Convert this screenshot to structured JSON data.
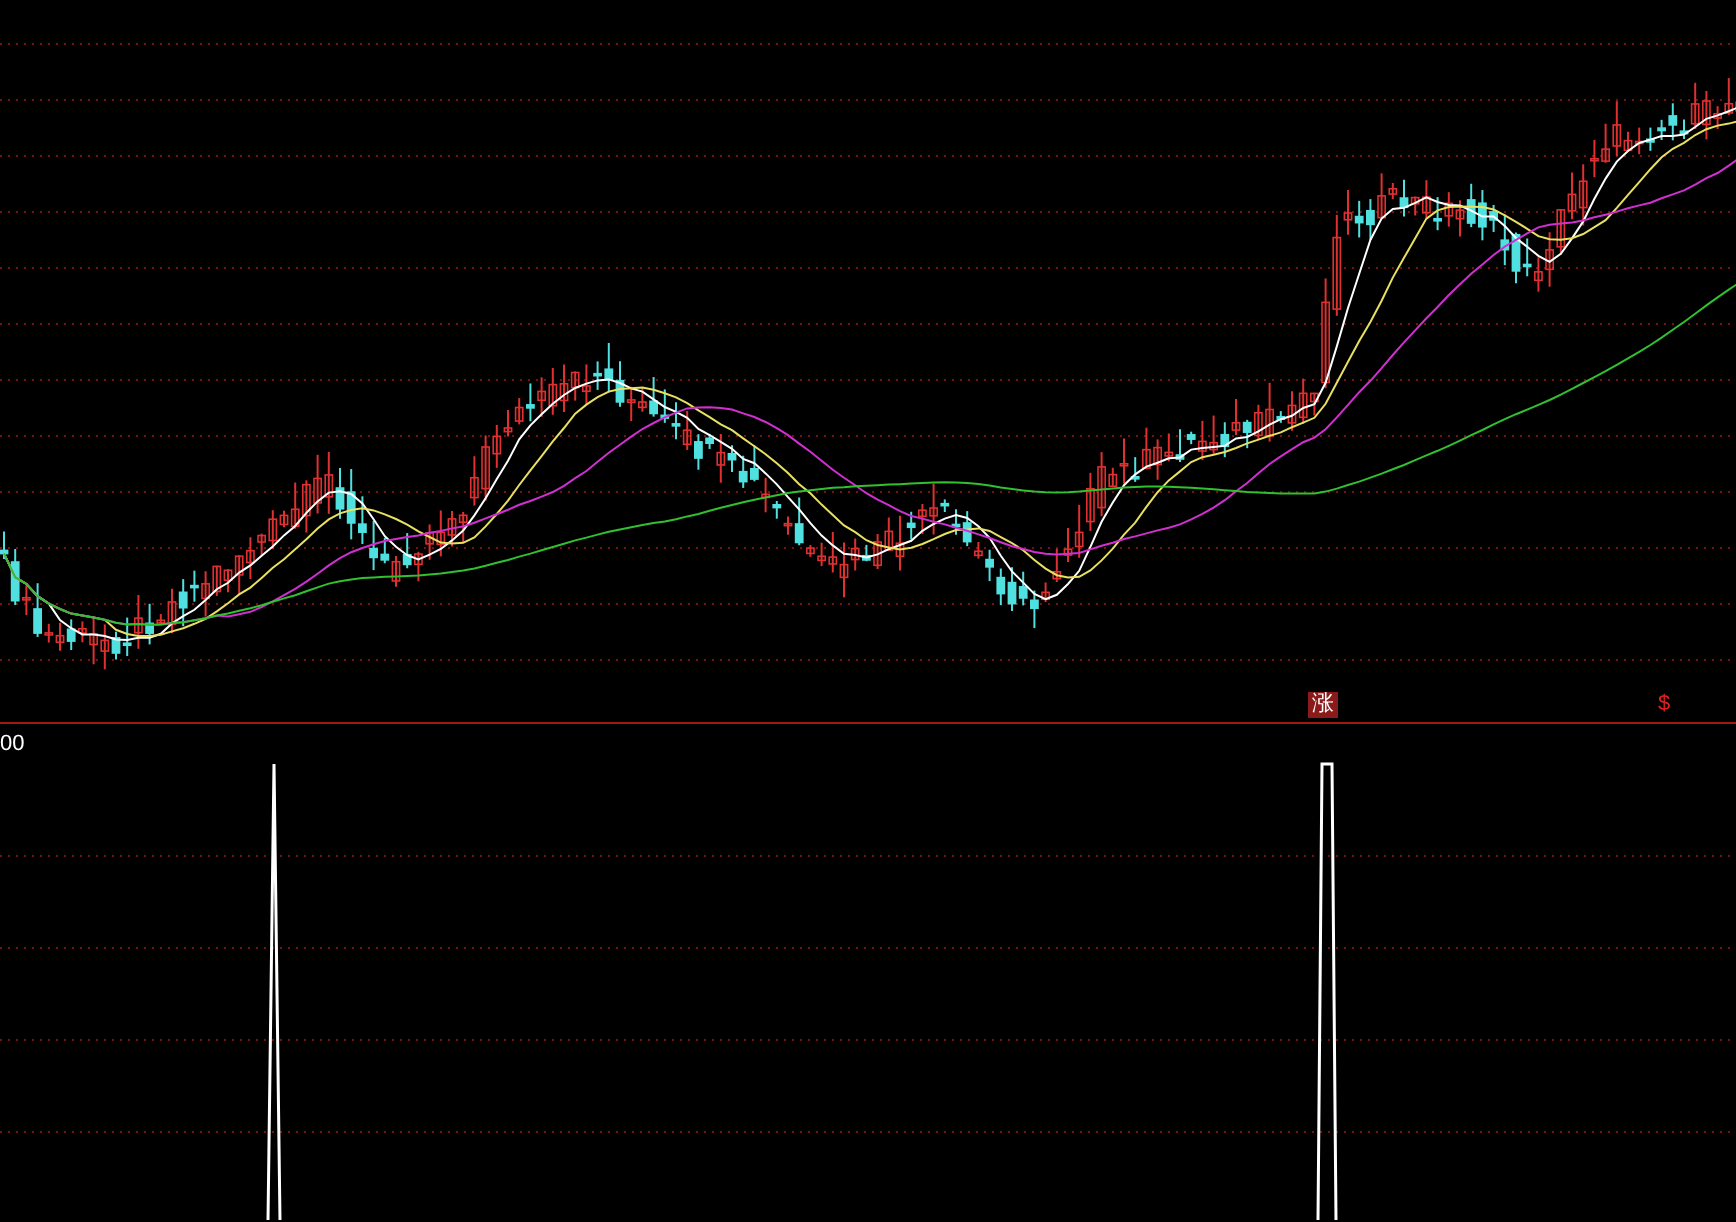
{
  "price_panel": {
    "markers": [
      {
        "text": "涨",
        "kind": "badge"
      },
      {
        "text": "$",
        "kind": "plain"
      }
    ]
  },
  "indicator_panel": {
    "axis_label": "00"
  }
}
